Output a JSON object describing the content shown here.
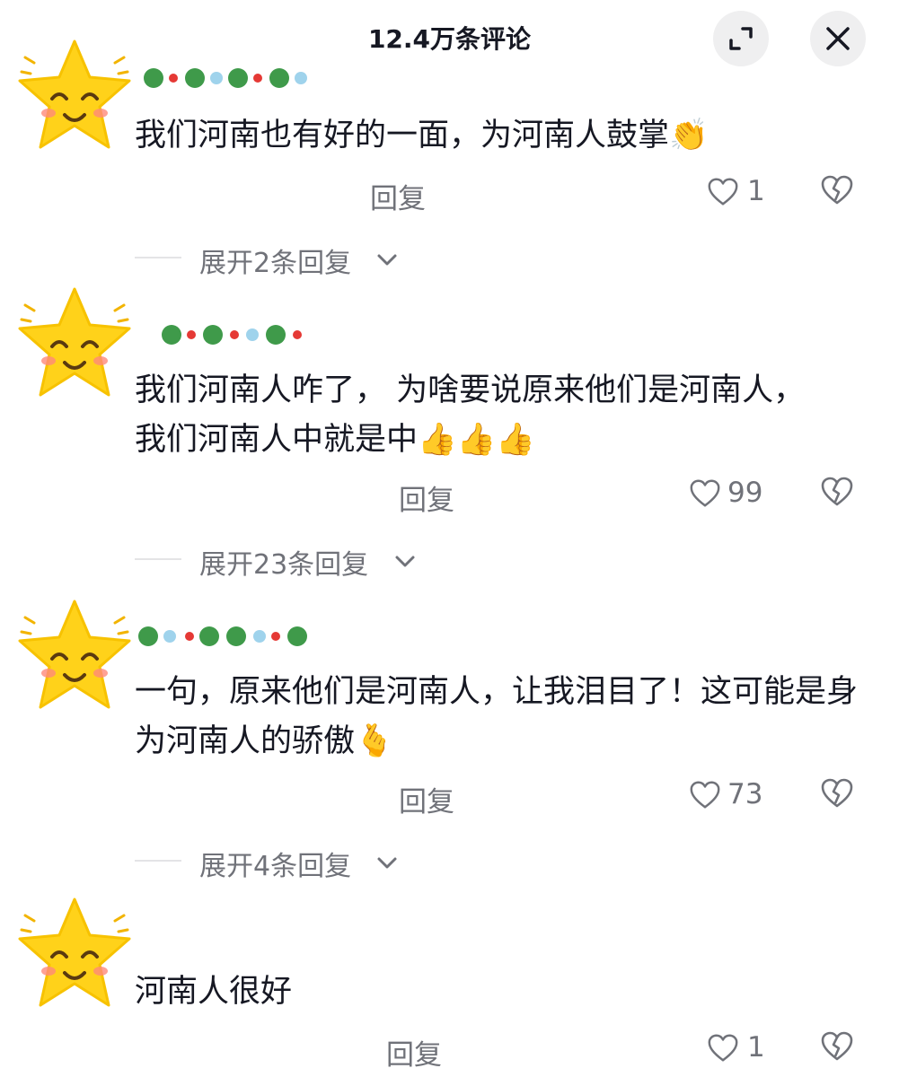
{
  "header": {
    "title": "12.4万条评论",
    "expand_icon": "expand-icon",
    "close_icon": "close-icon"
  },
  "colors": {
    "star_fill": "#ffd21a",
    "star_outline": "#f2b400",
    "text_primary": "#161823",
    "text_secondary": "#707279",
    "text_tertiary": "#a8a9ae"
  },
  "comments": [
    {
      "username": "",
      "text": "我们河南也有好的一面，为河南人鼓掌👏",
      "time_location": "",
      "reply_label": "回复",
      "like_count": "1",
      "expand_label": "展开2条回复"
    },
    {
      "username": "",
      "text": "我们河南人咋了， 为啥要说原来他们是河南人，我们河南人中就是中👍👍👍",
      "time_location": "",
      "reply_label": "回复",
      "like_count": "99",
      "expand_label": "展开23条回复"
    },
    {
      "username": "",
      "text": "一句，原来他们是河南人，让我泪目了！这可能是身为河南人的骄傲🫰",
      "time_location": "",
      "reply_label": "回复",
      "like_count": "73",
      "expand_label": "展开4条回复"
    },
    {
      "username": "",
      "text": "河南人很好",
      "time_location": "",
      "reply_label": "回复",
      "like_count": "1"
    }
  ]
}
